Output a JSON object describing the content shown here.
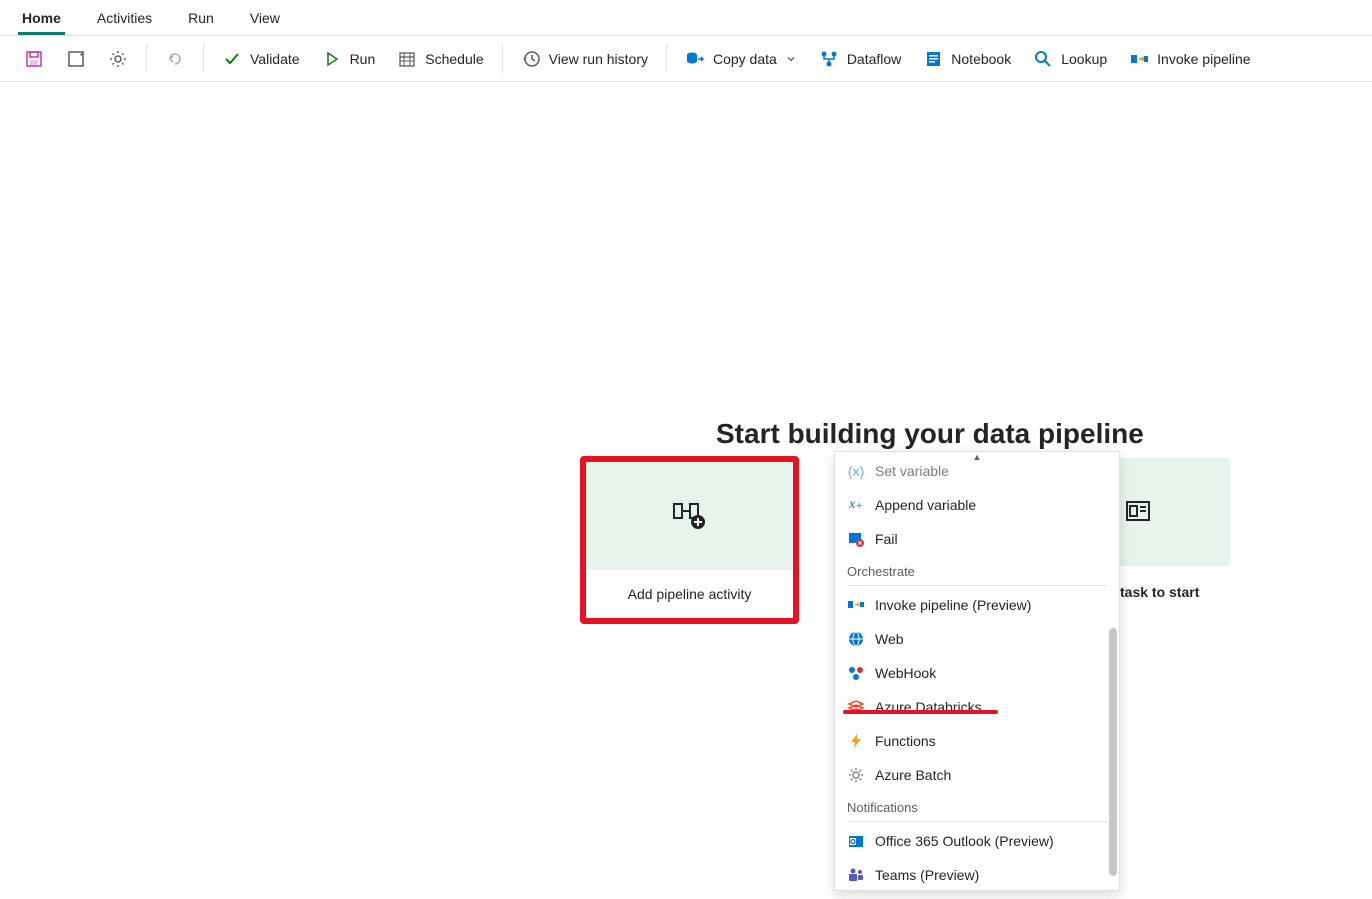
{
  "tabs": [
    "Home",
    "Activities",
    "Run",
    "View"
  ],
  "activeTab": 0,
  "toolbar": {
    "validate": "Validate",
    "run": "Run",
    "schedule": "Schedule",
    "history": "View run history",
    "copydata": "Copy data",
    "dataflow": "Dataflow",
    "notebook": "Notebook",
    "lookup": "Lookup",
    "invoke": "Invoke pipeline"
  },
  "headline": "Start building your data pipeline",
  "cardAdd": "Add pipeline activity",
  "cardTask": "task to start",
  "dropdown": {
    "setVariable": "Set variable",
    "appendVariable": "Append variable",
    "fail": "Fail",
    "orchestrate": "Orchestrate",
    "invokePipeline": "Invoke pipeline (Preview)",
    "web": "Web",
    "webhook": "WebHook",
    "azureDatabricks": "Azure Databricks",
    "functions": "Functions",
    "azureBatch": "Azure Batch",
    "notifications": "Notifications",
    "office365": "Office 365 Outlook (Preview)",
    "teams": "Teams (Preview)"
  }
}
